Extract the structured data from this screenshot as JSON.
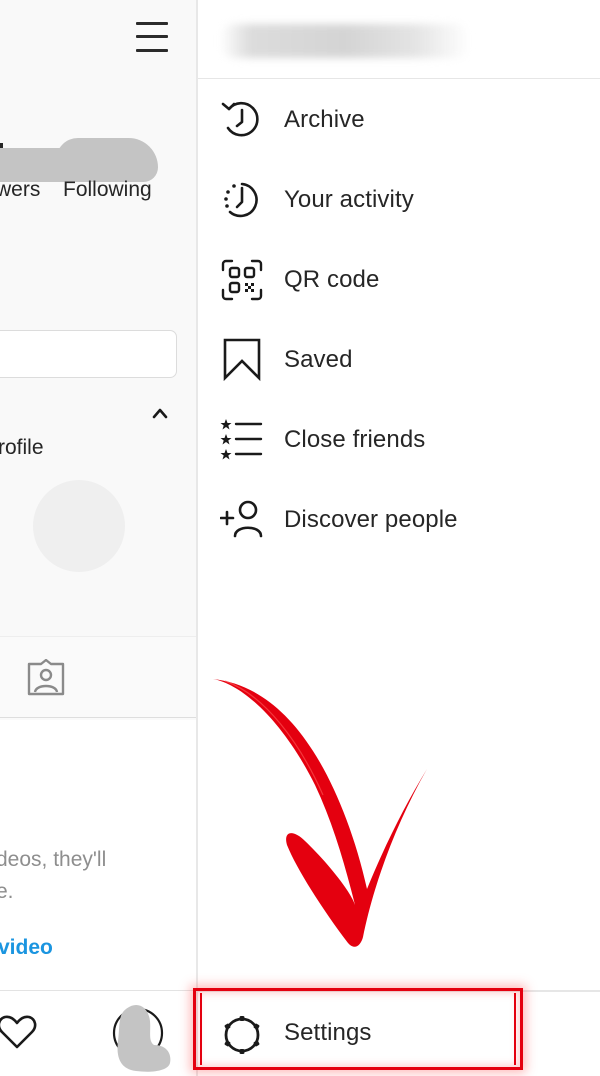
{
  "left_panel": {
    "stats": {
      "followers_partial": "wers",
      "following": "Following"
    },
    "profile_section_partial": "rofile",
    "empty_state": {
      "line1_partial": "deos, they'll",
      "line2_partial": "e.",
      "link_partial": "video"
    }
  },
  "drawer": {
    "username": "",
    "items": [
      {
        "label": "Archive",
        "icon": "archive-icon"
      },
      {
        "label": "Your activity",
        "icon": "activity-icon"
      },
      {
        "label": "QR code",
        "icon": "qr-code-icon"
      },
      {
        "label": "Saved",
        "icon": "bookmark-icon"
      },
      {
        "label": "Close friends",
        "icon": "close-friends-icon"
      },
      {
        "label": "Discover people",
        "icon": "add-person-icon"
      }
    ],
    "settings": {
      "label": "Settings",
      "icon": "gear-icon"
    }
  },
  "annotation": {
    "arrow_color": "#e4000f",
    "highlight_color": "#e4000f",
    "highlight_target": "Settings"
  },
  "colors": {
    "text": "#262626",
    "muted_text": "#8e8e8e",
    "link": "#1b95e0",
    "divider": "#e6e6e6"
  }
}
